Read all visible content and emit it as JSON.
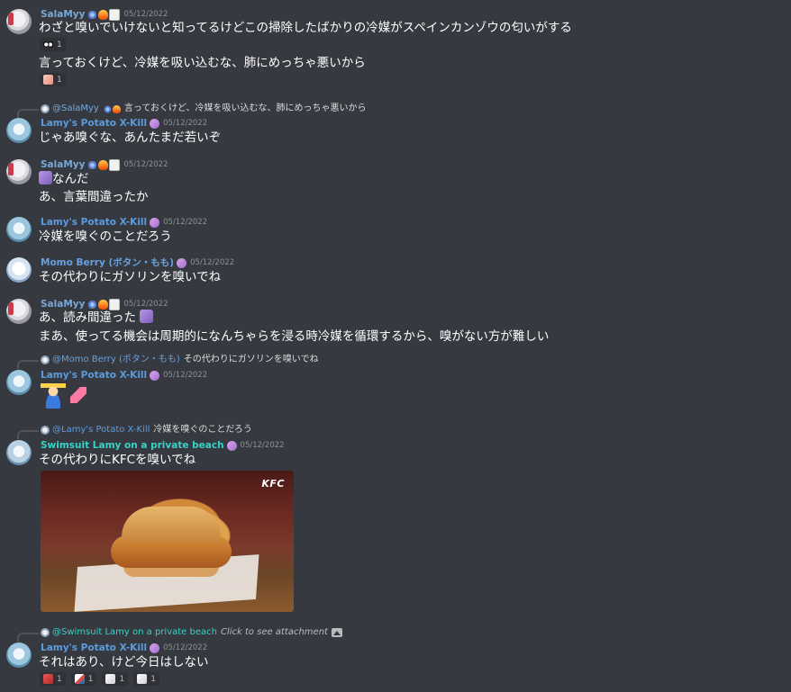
{
  "messages": [
    {
      "author": "SalaMyy",
      "date": "05/12/2022",
      "lines": [
        "わざと嗅いでいけないと知ってるけどこの掃除したばかりの冷媒がスペインカンゾウの匂いがする",
        "言っておくけど、冷媒を吸い込むな、肺にめっちゃ悪いから"
      ],
      "reactions": [
        {
          "emoji": "eyes-emoji",
          "count": "1"
        },
        {
          "emoji": "sticker-emoji",
          "count": "1"
        }
      ]
    },
    {
      "reply_to": {
        "author": "@SalaMyy",
        "text": "言っておくけど、冷媒を吸い込むな、肺にめっちゃ悪いから"
      },
      "author": "Lamy's Potato X-Kill",
      "date": "05/12/2022",
      "lines": [
        "じゃあ嗅ぐな、あんたまだ若いぞ"
      ]
    },
    {
      "author": "SalaMyy",
      "date": "05/12/2022",
      "lines": [
        "なんだ",
        "あ、言葉間違ったか"
      ]
    },
    {
      "author": "Lamy's Potato X-Kill",
      "date": "05/12/2022",
      "lines": [
        "冷媒を嗅ぐのことだろう"
      ]
    },
    {
      "author": "Momo Berry (ボタン・もも)",
      "date": "05/12/2022",
      "lines": [
        "その代わりにガソリンを嗅いでね"
      ]
    },
    {
      "author": "SalaMyy",
      "date": "05/12/2022",
      "lines": [
        "あ、読み間違った",
        "まあ、使ってる機会は周期的になんちゃらを浸る時冷媒を循環するから、嗅がない方が難しい"
      ]
    },
    {
      "reply_to": {
        "author": "@Momo Berry (ボタン・もも)",
        "text": "その代わりにガソリンを嗅いでね"
      },
      "author": "Lamy's Potato X-Kill",
      "date": "05/12/2022",
      "lines": []
    },
    {
      "reply_to": {
        "author": "@Lamy's Potato X-Kill",
        "text": "冷媒を嗅ぐのことだろう"
      },
      "author": "Swimsuit Lamy on a private beach",
      "date": "05/12/2022",
      "lines": [
        "その代わりにKFCを嗅いでね"
      ],
      "image": {
        "brand_text": "KFC"
      }
    },
    {
      "reply_to": {
        "author": "@Swimsuit Lamy on a private beach",
        "text": "Click to see attachment"
      },
      "author": "Lamy's Potato X-Kill",
      "date": "05/12/2022",
      "lines": [
        "それはあり、けど今日はしない"
      ],
      "reactions": [
        {
          "emoji": "red-emoji",
          "count": "1"
        },
        {
          "emoji": "mixed-emoji",
          "count": "1"
        },
        {
          "emoji": "card-emoji",
          "count": "1"
        },
        {
          "emoji": "white-emoji",
          "count": "1"
        }
      ]
    }
  ],
  "colors": {
    "background": "#36393f",
    "name_sala": "#7aa8d6",
    "name_lamy": "#5b9cde",
    "name_swim": "#37d3c9",
    "timestamp": "#8e9297"
  }
}
